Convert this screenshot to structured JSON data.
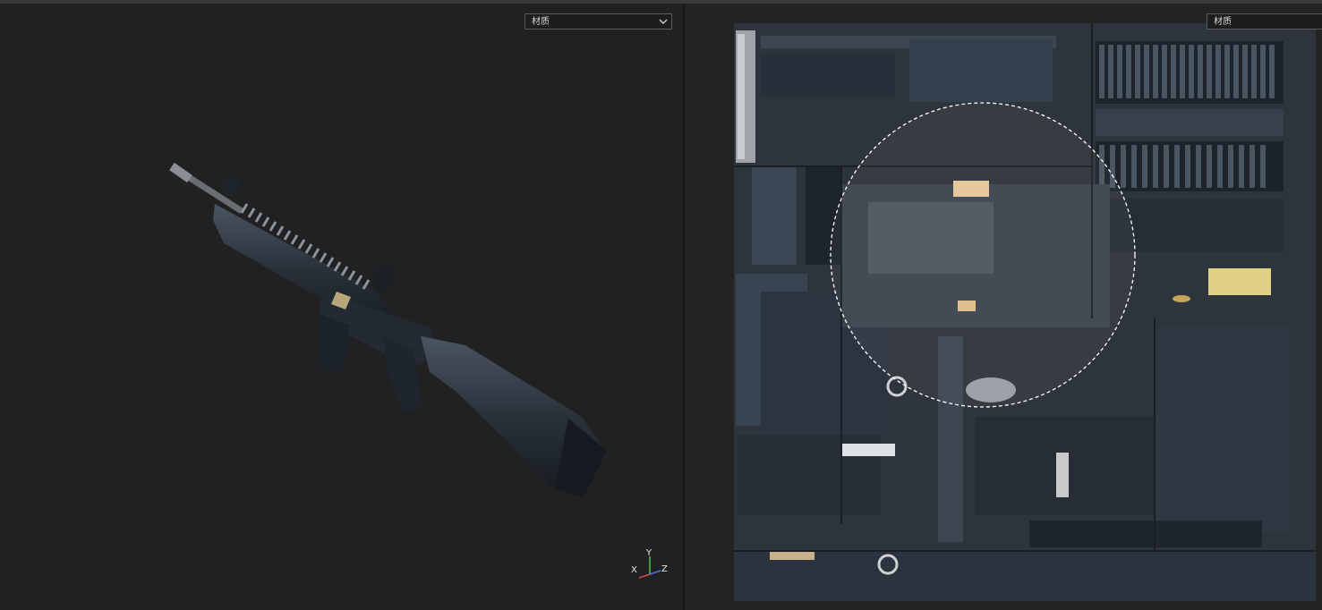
{
  "left_viewport": {
    "material_dropdown": {
      "label": "材质",
      "icon": "chevron-down-icon"
    },
    "axis_gizmo": {
      "x": "X",
      "y": "Y",
      "z": "Z"
    },
    "model": "rifle-3d-model"
  },
  "right_viewport": {
    "material_dropdown": {
      "label": "材质"
    },
    "texture": "uv-texture-atlas",
    "brush_cursor": "dashed-circle-brush"
  },
  "colors": {
    "background": "#212121",
    "axis_x": "#d05050",
    "axis_y": "#50c050",
    "axis_z": "#5070e0"
  }
}
